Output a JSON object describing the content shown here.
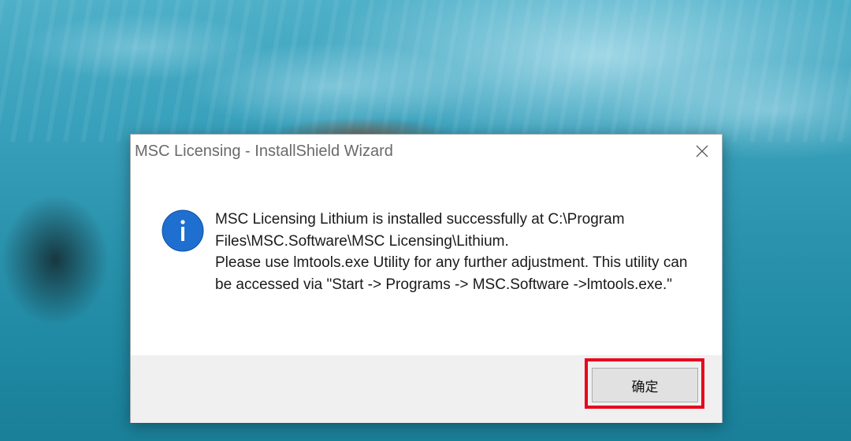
{
  "window": {
    "title": "MSC Licensing - InstallShield Wizard",
    "close_icon": "close-icon"
  },
  "message": {
    "icon": "info-icon",
    "line1": "MSC Licensing Lithium is installed successfully at C:\\Program Files\\MSC.Software\\MSC Licensing\\Lithium.",
    "line2": "Please use lmtools.exe Utility for any further adjustment. This utility can be accessed via \"Start -> Programs -> MSC.Software ->lmtools.exe.\""
  },
  "footer": {
    "ok_label": "确定"
  },
  "colors": {
    "info_icon": "#1f6fd0",
    "highlight": "#e8001c"
  }
}
